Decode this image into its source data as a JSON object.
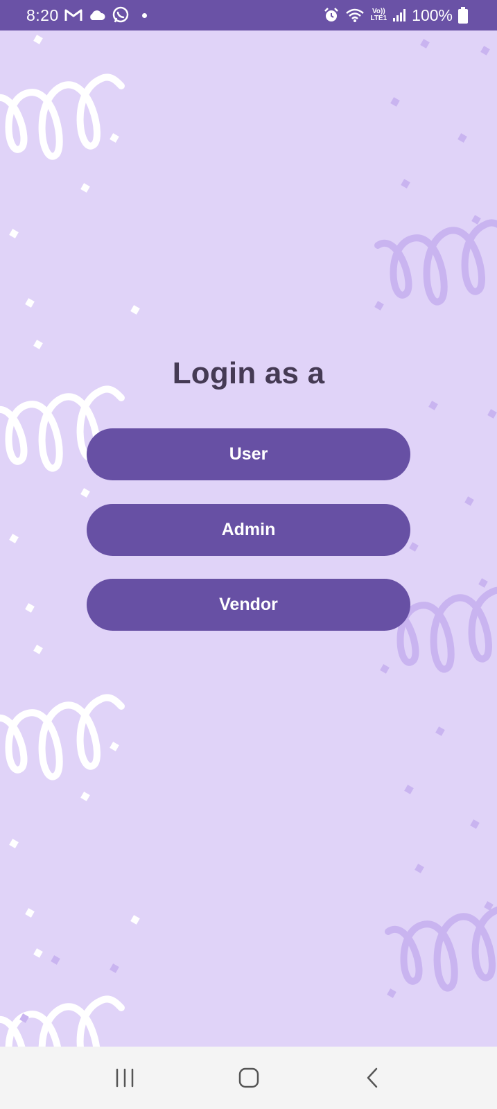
{
  "status_bar": {
    "time": "8:20",
    "battery": "100%",
    "notification_icons": [
      "gmail-icon",
      "cloud-icon",
      "whatsapp-icon",
      "dot-icon"
    ],
    "system_icons": [
      "alarm-icon",
      "wifi-icon",
      "volte-icon",
      "signal-icon",
      "battery-icon"
    ],
    "volte_label_top": "Vo))",
    "volte_label_bottom": "LTE1"
  },
  "login": {
    "title": "Login as a",
    "buttons": [
      {
        "label": "User"
      },
      {
        "label": "Admin"
      },
      {
        "label": "Vendor"
      }
    ]
  },
  "nav_bar": {
    "icons": [
      "recent-apps-icon",
      "home-icon",
      "back-icon"
    ]
  },
  "colors": {
    "status_bar": "#6a52a6",
    "background": "#e0d3f8",
    "button": "#6750a4",
    "title_text": "#453a54",
    "nav_bar": "#f4f4f4"
  }
}
